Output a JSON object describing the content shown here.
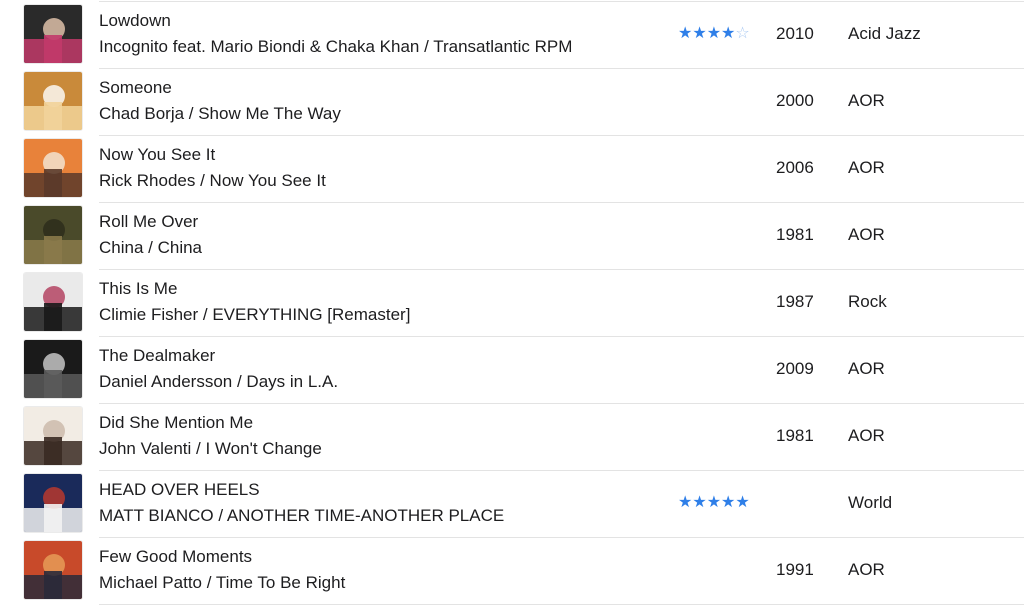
{
  "colors": {
    "star_active": "#2f7fe8",
    "star_empty": "#a8c8f2",
    "separator": "#e3e3e3"
  },
  "songs": [
    {
      "title": "Lowdown",
      "subtitle": "Incognito feat. Mario Biondi & Chaka Khan / Transatlantic RPM",
      "rating": 4,
      "year": "2010",
      "genre": "Acid Jazz",
      "art_colors": [
        "#2a2a2a",
        "#c23a6a",
        "#e9c9b0"
      ]
    },
    {
      "title": "Someone",
      "subtitle": "Chad Borja / Show Me The Way",
      "rating": 0,
      "year": "2000",
      "genre": "AOR",
      "art_colors": [
        "#c98a3a",
        "#f2d39a",
        "#ffffff"
      ]
    },
    {
      "title": "Now You See It",
      "subtitle": "Rick Rhodes / Now You See It",
      "rating": 0,
      "year": "2006",
      "genre": "AOR",
      "art_colors": [
        "#e8823a",
        "#5a3a2a",
        "#f3e9d9"
      ]
    },
    {
      "title": "Roll Me Over",
      "subtitle": "China / China",
      "rating": 0,
      "year": "1981",
      "genre": "AOR",
      "art_colors": [
        "#4a4a2a",
        "#8a7a4a",
        "#2a2a1a"
      ]
    },
    {
      "title": "This Is Me",
      "subtitle": "Climie Fisher / EVERYTHING [Remaster]",
      "rating": 0,
      "year": "1987",
      "genre": "Rock",
      "art_colors": [
        "#eaeaea",
        "#1a1a1a",
        "#b03a5a"
      ]
    },
    {
      "title": "The Dealmaker",
      "subtitle": "Daniel Andersson / Days in L.A.",
      "rating": 0,
      "year": "2009",
      "genre": "AOR",
      "art_colors": [
        "#1a1a1a",
        "#5a5a5a",
        "#cfcfcf"
      ]
    },
    {
      "title": "Did She Mention Me",
      "subtitle": "John Valenti / I Won't Change",
      "rating": 0,
      "year": "1981",
      "genre": "AOR",
      "art_colors": [
        "#f2ece4",
        "#3a2a22",
        "#c9b8a8"
      ]
    },
    {
      "title": "HEAD OVER HEELS",
      "subtitle": "MATT BIANCO / ANOTHER TIME-ANOTHER PLACE",
      "rating": 5,
      "year": "",
      "genre": "World",
      "art_colors": [
        "#1a2a5a",
        "#f2f2f2",
        "#c23a2a"
      ]
    },
    {
      "title": "Few Good Moments",
      "subtitle": "Michael Patto / Time To Be Right",
      "rating": 0,
      "year": "1991",
      "genre": "AOR",
      "art_colors": [
        "#c84a2a",
        "#2a2a3a",
        "#e8a05a"
      ]
    }
  ]
}
